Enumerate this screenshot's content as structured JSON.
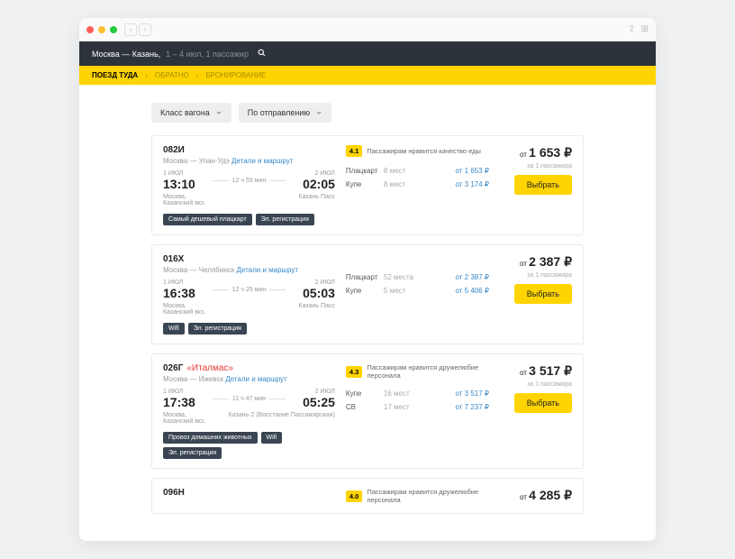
{
  "header": {
    "route": "Москва — Казань,",
    "detail": "1 – 4 июл, 1 пассажир"
  },
  "breadcrumb": {
    "active": "ПОЕЗД ТУДА",
    "step2": "ОБРАТНО",
    "step3": "БРОНИРОВАНИЕ"
  },
  "filters": {
    "wagon_class": "Класс вагона",
    "sort": "По отправлению"
  },
  "labels": {
    "price_from": "от",
    "per_pax": "за 1 пассажира",
    "select": "Выбрать",
    "currency": "₽",
    "details_link": "Детали и маршрут"
  },
  "trains": [
    {
      "number": "082И",
      "name": "",
      "route_from": "Москва",
      "route_to": "Улан-Удэ",
      "dep_date": "1 ИЮЛ",
      "dep_time": "13:10",
      "duration": "12 ч 55 мин",
      "arr_date": "2 ИЮЛ",
      "arr_time": "02:05",
      "dep_station": "Москва,\nКазанский вкз.",
      "arr_station": "Казань Пасс",
      "tags": [
        "Самый дешевый плацкарт",
        "Эл. регистрация"
      ],
      "rating": "4.1",
      "rating_text": "Пассажирам нравится качество еды",
      "classes": [
        {
          "name": "Плацкарт",
          "seats": "8 мест",
          "price": "от 1 653 ₽"
        },
        {
          "name": "Купе",
          "seats": "8 мест",
          "price": "от 3 174 ₽"
        }
      ],
      "price": "1 653"
    },
    {
      "number": "016Х",
      "name": "",
      "route_from": "Москва",
      "route_to": "Челябинск",
      "dep_date": "1 ИЮЛ",
      "dep_time": "16:38",
      "duration": "12 ч 25 мин",
      "arr_date": "2 ИЮЛ",
      "arr_time": "05:03",
      "dep_station": "Москва,\nКазанский вкз.",
      "arr_station": "Казань Пасс",
      "tags": [
        "Wifi",
        "Эл. регистрация"
      ],
      "rating": "",
      "rating_text": "",
      "classes": [
        {
          "name": "Плацкарт",
          "seats": "52 места",
          "price": "от 2 387 ₽"
        },
        {
          "name": "Купе",
          "seats": "5 мест",
          "price": "от 5 406 ₽"
        }
      ],
      "price": "2 387"
    },
    {
      "number": "026Г",
      "name": "«Италмас»",
      "route_from": "Москва",
      "route_to": "Ижевск",
      "dep_date": "1 ИЮЛ",
      "dep_time": "17:38",
      "duration": "11 ч 47 мин",
      "arr_date": "2 ИЮЛ",
      "arr_time": "05:25",
      "dep_station": "Москва,\nКазанский вкз.",
      "arr_station": "Казань-2 (Восстание Пассажирская)",
      "tags": [
        "Провоз домашних животных",
        "Wifi",
        "Эл. регистрация"
      ],
      "rating": "4.3",
      "rating_text": "Пассажирам нравится дружелюбие персонала",
      "classes": [
        {
          "name": "Купе",
          "seats": "16 мест",
          "price": "от 3 517 ₽"
        },
        {
          "name": "СВ",
          "seats": "17 мест",
          "price": "от 7 237 ₽"
        }
      ],
      "price": "3 517"
    },
    {
      "number": "096Н",
      "name": "",
      "route_from": "",
      "route_to": "",
      "dep_date": "",
      "dep_time": "",
      "duration": "",
      "arr_date": "",
      "arr_time": "",
      "dep_station": "",
      "arr_station": "",
      "tags": [],
      "rating": "4.0",
      "rating_text": "Пассажирам нравится дружелюбие персонала",
      "classes": [],
      "price": "4 285"
    }
  ]
}
